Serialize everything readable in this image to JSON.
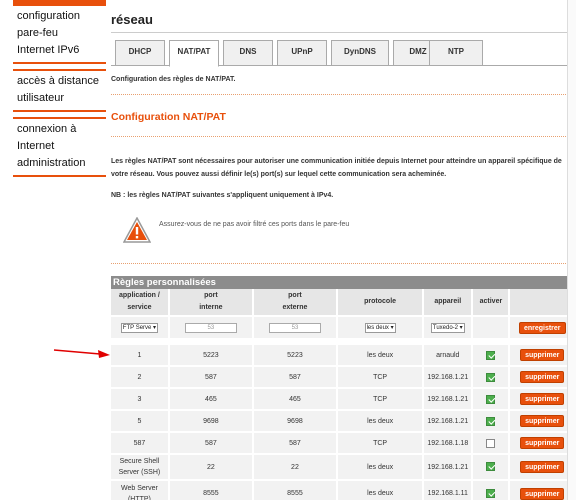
{
  "sidebar": {
    "groups": [
      {
        "items": [
          "configuration",
          "pare-feu",
          "Internet IPv6"
        ]
      },
      {
        "items": [
          "accès à distance",
          "utilisateur"
        ]
      },
      {
        "items": [
          "connexion à",
          "Internet",
          "administration"
        ]
      }
    ]
  },
  "page": {
    "title": "réseau"
  },
  "tabs": [
    "DHCP",
    "NAT/PAT",
    "DNS",
    "UPnP",
    "DynDNS",
    "DMZ",
    "NTP"
  ],
  "active_tab": "NAT/PAT",
  "subtitle": "Configuration des règles de NAT/PAT.",
  "section_title": "Configuration NAT/PAT",
  "paragraph": "Les règles NAT/PAT sont nécessaires pour autoriser une communication initiée depuis Internet pour atteindre un appareil spécifique de votre réseau. Vous pouvez aussi définir le(s) port(s) sur lequel cette communication sera acheminée.",
  "nb": "NB : les règles NAT/PAT suivantes s'appliquent uniquement à IPv4.",
  "warning": "Assurez-vous de ne pas avoir filtré ces ports dans le pare-feu",
  "rules": {
    "header": "Règles personnalisées",
    "columns": {
      "service_l1": "application /",
      "service_l2": "service",
      "internal_l1": "port",
      "internal_l2": "interne",
      "external_l1": "port",
      "external_l2": "externe",
      "protocol": "protocole",
      "device": "appareil",
      "active": "activer"
    },
    "add_row": {
      "service": "FTP Serve",
      "internal_placeholder": "53",
      "external_placeholder": "53",
      "protocol": "les deux",
      "device": "Tuxedo-2",
      "save": "enregistrer"
    },
    "delete_label": "supprimer",
    "rows": [
      {
        "service": "1",
        "internal": "5223",
        "external": "5223",
        "protocol": "les deux",
        "device": "arnauld",
        "active": true
      },
      {
        "service": "2",
        "internal": "587",
        "external": "587",
        "protocol": "TCP",
        "device": "192.168.1.21",
        "active": true
      },
      {
        "service": "3",
        "internal": "465",
        "external": "465",
        "protocol": "TCP",
        "device": "192.168.1.21",
        "active": true
      },
      {
        "service": "5",
        "internal": "9698",
        "external": "9698",
        "protocol": "les deux",
        "device": "192.168.1.21",
        "active": true
      },
      {
        "service": "587",
        "internal": "587",
        "external": "587",
        "protocol": "TCP",
        "device": "192.168.1.18",
        "active": false
      },
      {
        "service": "Secure Shell Server (SSH)",
        "internal": "22",
        "external": "22",
        "protocol": "les deux",
        "device": "192.168.1.21",
        "active": true
      },
      {
        "service": "Web Server (HTTP)",
        "internal": "8555",
        "external": "8555",
        "protocol": "les deux",
        "device": "192.168.1.11",
        "active": true
      }
    ]
  },
  "colors": {
    "accent": "#e8500c",
    "table_header": "#8c8c8c",
    "check_on": "#4cae4c",
    "arrow": "#e00000"
  }
}
